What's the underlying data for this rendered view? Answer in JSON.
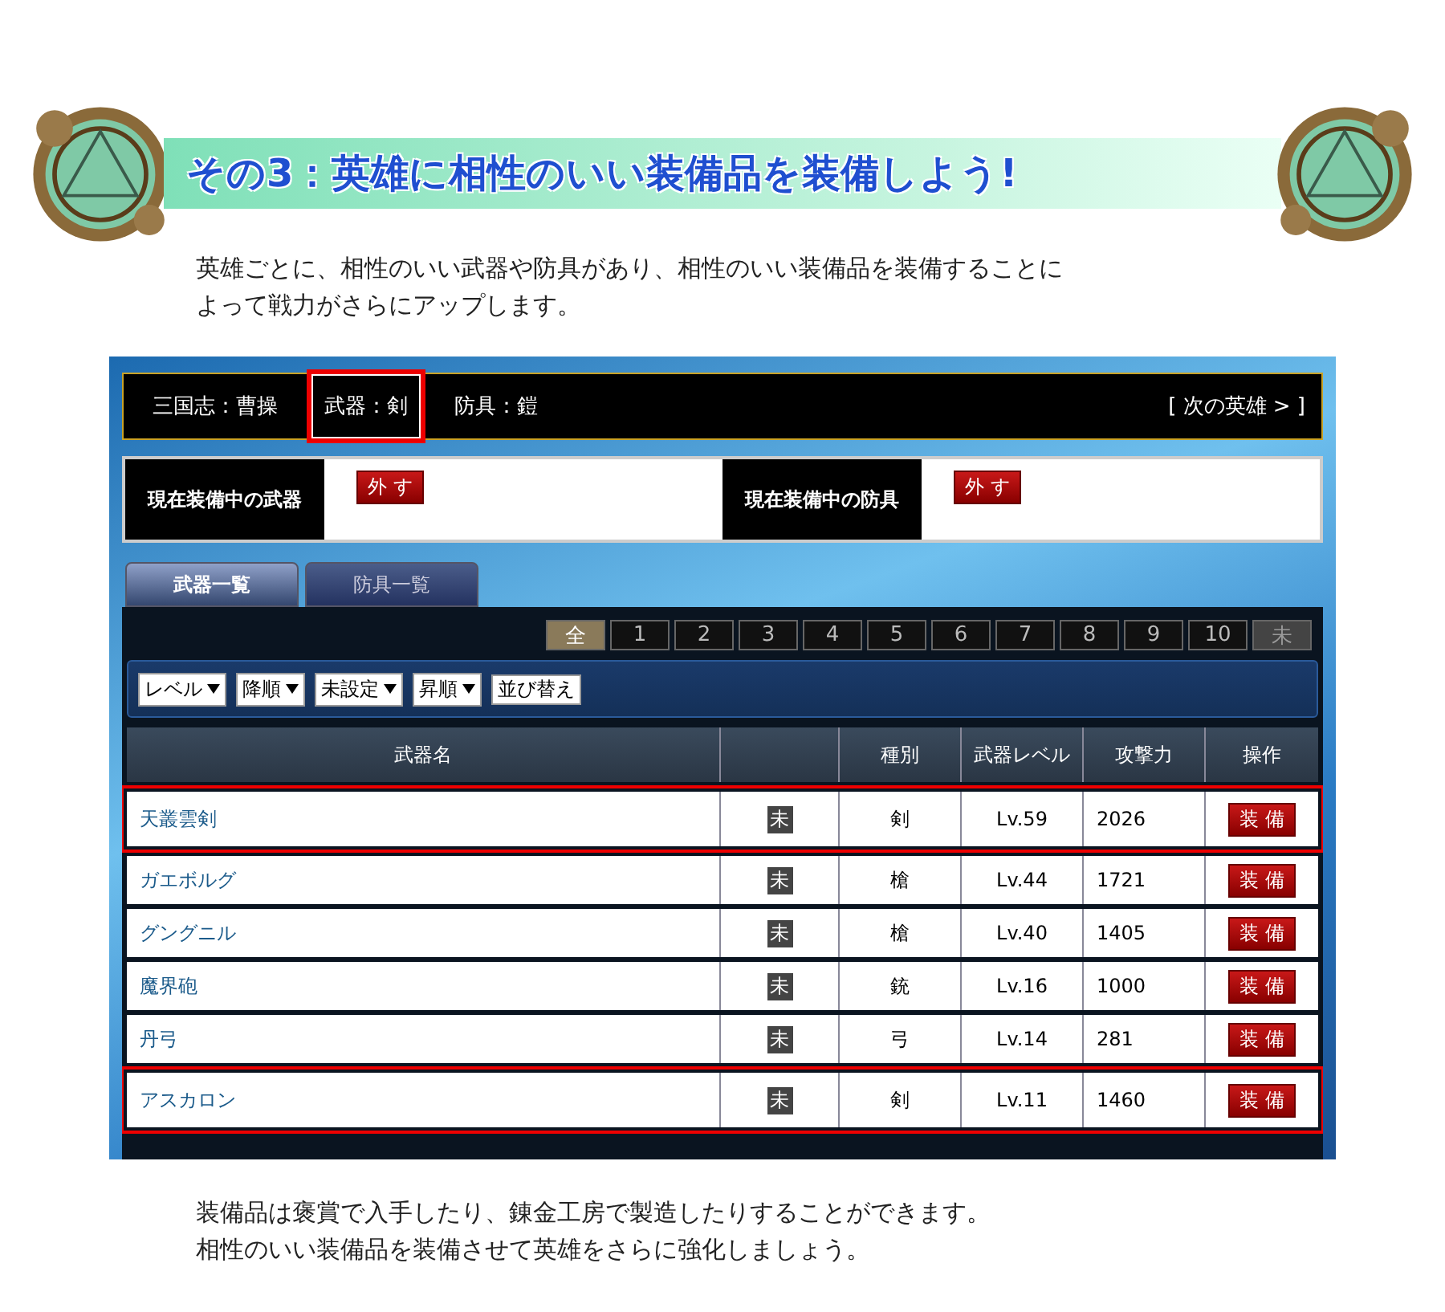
{
  "title": "その3：英雄に相性のいい装備品を装備しよう!",
  "intro": [
    "英雄ごとに、相性のいい武器や防具があり、相性のいい装備品を装備することに",
    "よって戦力がさらにアップします。"
  ],
  "hero_bar": {
    "items": [
      {
        "label": "三国志：曹操",
        "highlighted": false
      },
      {
        "label": "武器：剣",
        "highlighted": true
      },
      {
        "label": "防具：鎧",
        "highlighted": false
      }
    ],
    "next": "[ 次の英雄 > ]"
  },
  "equipped": [
    {
      "label": "現在装備中の武器",
      "button": "外 す"
    },
    {
      "label": "現在装備中の防具",
      "button": "外 す"
    }
  ],
  "tabs": [
    {
      "label": "武器一覧",
      "selected": true
    },
    {
      "label": "防具一覧",
      "selected": false
    }
  ],
  "filters": [
    {
      "label": "全",
      "selected": true,
      "disabled": false
    },
    {
      "label": "1",
      "selected": false,
      "disabled": false
    },
    {
      "label": "2",
      "selected": false,
      "disabled": false
    },
    {
      "label": "3",
      "selected": false,
      "disabled": false
    },
    {
      "label": "4",
      "selected": false,
      "disabled": false
    },
    {
      "label": "5",
      "selected": false,
      "disabled": false
    },
    {
      "label": "6",
      "selected": false,
      "disabled": false
    },
    {
      "label": "7",
      "selected": false,
      "disabled": false
    },
    {
      "label": "8",
      "selected": false,
      "disabled": false
    },
    {
      "label": "9",
      "selected": false,
      "disabled": false
    },
    {
      "label": "10",
      "selected": false,
      "disabled": false
    },
    {
      "label": "未",
      "selected": false,
      "disabled": true
    }
  ],
  "sort": {
    "dropdowns": [
      "レベル",
      "降順",
      "未設定",
      "昇順"
    ],
    "button": "並び替え"
  },
  "table": {
    "columns": [
      "武器名",
      "",
      "種別",
      "武器レベル",
      "攻撃力",
      "操作"
    ],
    "rows": [
      {
        "name": "天叢雲剣",
        "badge": "未",
        "type": "剣",
        "level": "Lv.59",
        "attack": "2026",
        "action": "装 備",
        "highlighted": true
      },
      {
        "name": "ガエボルグ",
        "badge": "未",
        "type": "槍",
        "level": "Lv.44",
        "attack": "1721",
        "action": "装 備",
        "highlighted": false
      },
      {
        "name": "グングニル",
        "badge": "未",
        "type": "槍",
        "level": "Lv.40",
        "attack": "1405",
        "action": "装 備",
        "highlighted": false
      },
      {
        "name": "魔界砲",
        "badge": "未",
        "type": "銃",
        "level": "Lv.16",
        "attack": "1000",
        "action": "装 備",
        "highlighted": false
      },
      {
        "name": "丹弓",
        "badge": "未",
        "type": "弓",
        "level": "Lv.14",
        "attack": "281",
        "action": "装 備",
        "highlighted": false
      },
      {
        "name": "アスカロン",
        "badge": "未",
        "type": "剣",
        "level": "Lv.11",
        "attack": "1460",
        "action": "装 備",
        "highlighted": true
      }
    ]
  },
  "outro": [
    "装備品は褒賞で入手したり、錬金工房で製造したりすることができます。",
    "相性のいい装備品を装備させて英雄をさらに強化しましょう。"
  ]
}
